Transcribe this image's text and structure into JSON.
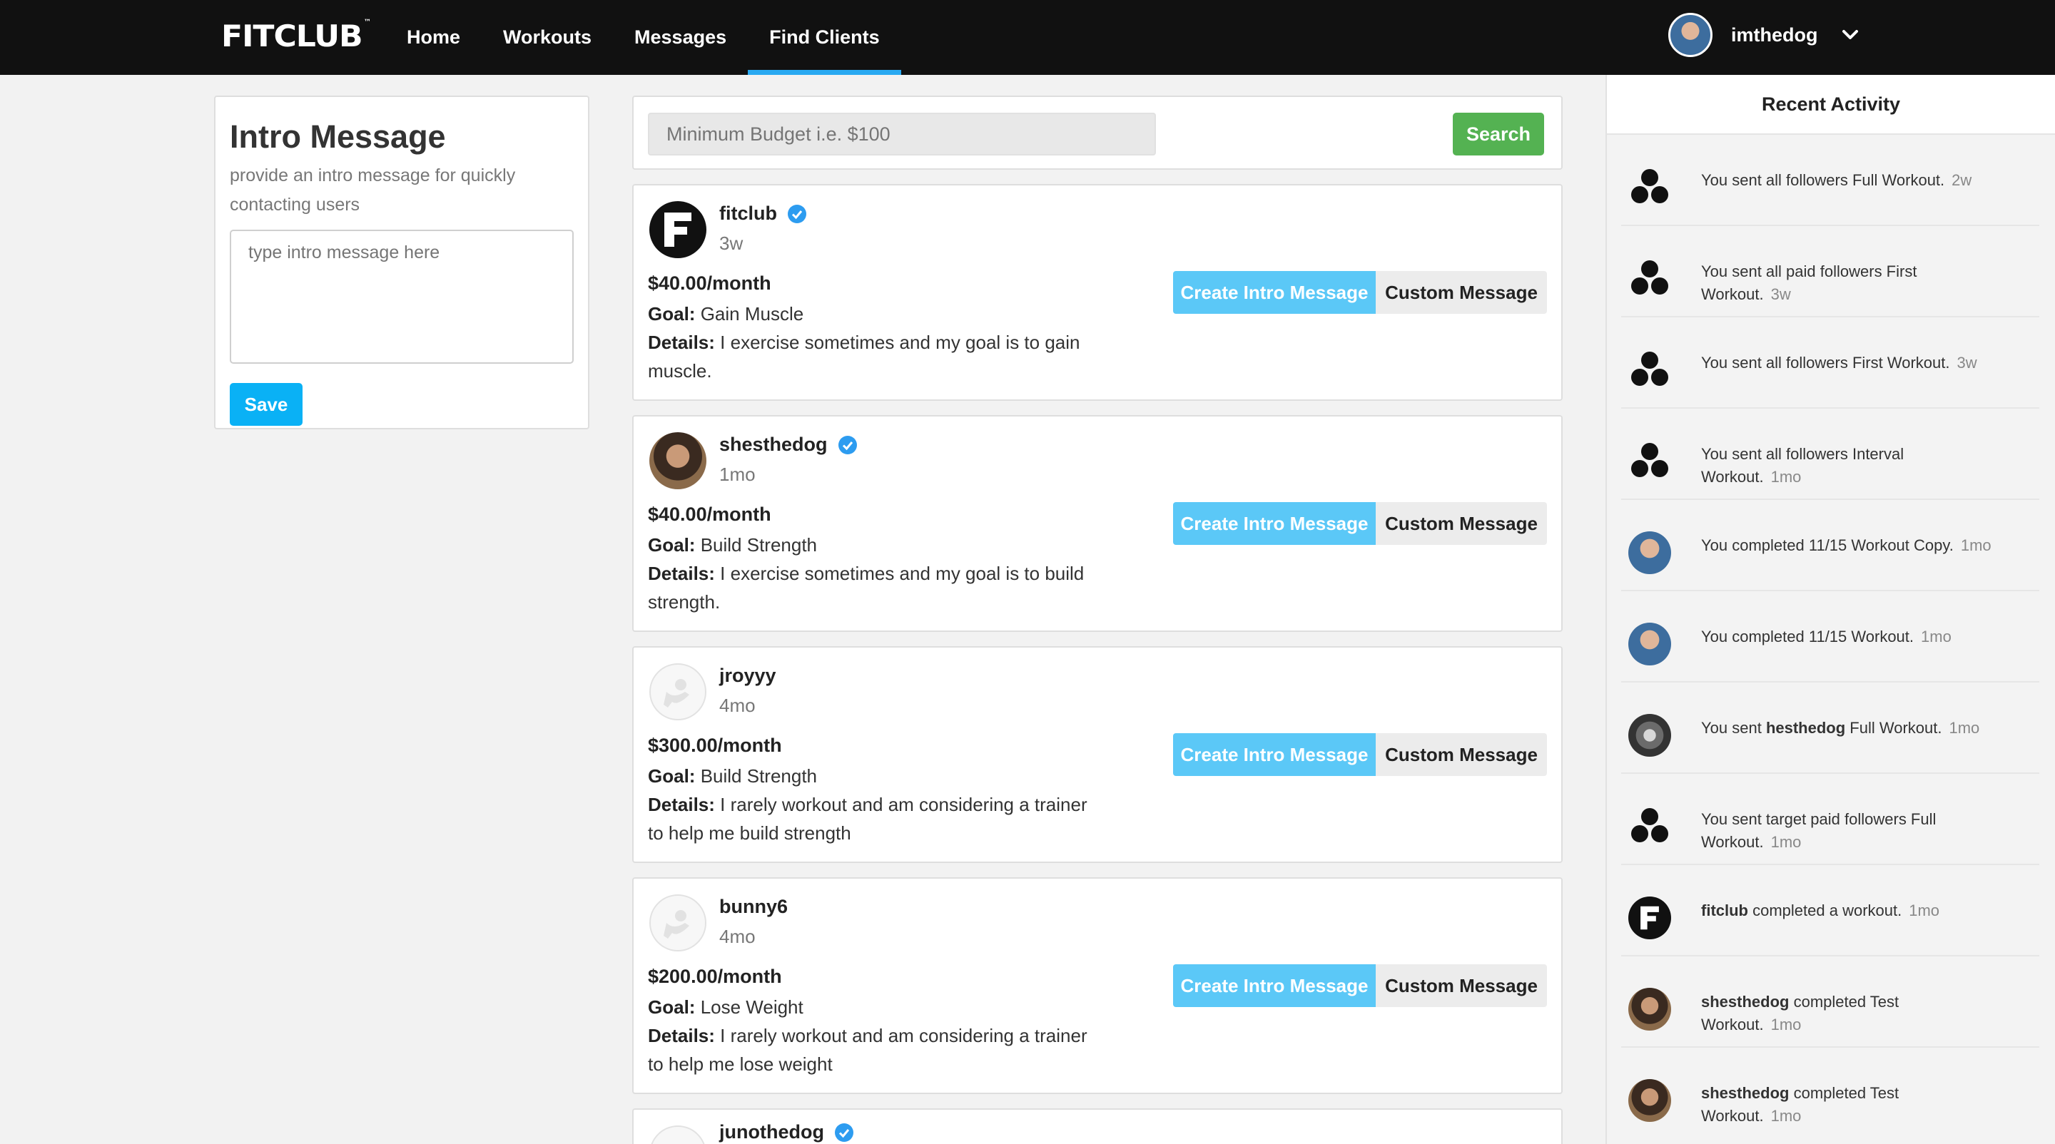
{
  "nav": {
    "brand": "FITCLUB",
    "links": [
      "Home",
      "Workouts",
      "Messages",
      "Find Clients"
    ],
    "active_index": 3,
    "username": "imthedog"
  },
  "intro": {
    "title": "Intro Message",
    "description": "provide an intro message for quickly contacting users",
    "textarea_placeholder": "type intro message here",
    "save_label": "Save"
  },
  "search": {
    "placeholder": "Minimum Budget i.e. $100",
    "button_label": "Search"
  },
  "clients": [
    {
      "name": "fitclub",
      "verified": true,
      "time": "3w",
      "price": "$40.00/month",
      "goal": "Gain Muscle",
      "details": "I exercise sometimes and my goal is to gain muscle.",
      "avatar": "fitclub-logo"
    },
    {
      "name": "shesthedog",
      "verified": true,
      "time": "1mo",
      "price": "$40.00/month",
      "goal": "Build Strength",
      "details": "I exercise sometimes and my goal is to build strength.",
      "avatar": "photo"
    },
    {
      "name": "jroyyy",
      "verified": false,
      "time": "4mo",
      "price": "$300.00/month",
      "goal": "Build Strength",
      "details": "I rarely workout and am considering a trainer to help me build strength",
      "avatar": "default"
    },
    {
      "name": "bunny6",
      "verified": false,
      "time": "4mo",
      "price": "$200.00/month",
      "goal": "Lose Weight",
      "details": "I rarely workout and am considering a trainer to help me lose weight",
      "avatar": "default"
    },
    {
      "name": "junothedog",
      "verified": true,
      "avatar": "default"
    }
  ],
  "labels": {
    "goal": "Goal:",
    "details": "Details:",
    "create_intro": "Create Intro Message",
    "custom_message": "Custom Message"
  },
  "activity": {
    "title": "Recent Activity",
    "items": [
      {
        "icon": "three-dots-icon",
        "bold": "",
        "text": "You sent all followers Full Workout.",
        "time": "2w"
      },
      {
        "icon": "three-dots-icon",
        "bold": "",
        "text": "You sent all paid followers First Workout.",
        "time": "3w"
      },
      {
        "icon": "three-dots-icon",
        "bold": "",
        "text": "You sent all followers First Workout.",
        "time": "3w"
      },
      {
        "icon": "three-dots-icon",
        "bold": "",
        "text": "You sent all followers Interval Workout.",
        "time": "1mo"
      },
      {
        "icon": "user-avatar",
        "bold": "",
        "text": "You completed 11/15 Workout Copy.",
        "time": "1mo"
      },
      {
        "icon": "user-avatar",
        "bold": "",
        "text": "You completed 11/15 Workout.",
        "time": "1mo"
      },
      {
        "icon": "wolf-avatar",
        "pre": "You sent ",
        "bold": "hesthedog",
        "text": " Full Workout.",
        "time": "1mo"
      },
      {
        "icon": "three-dots-icon",
        "bold": "",
        "text": "You sent target paid followers Full Workout.",
        "time": "1mo"
      },
      {
        "icon": "fitclub-logo",
        "bold": "fitclub",
        "text": " completed a workout.",
        "time": "1mo"
      },
      {
        "icon": "shes-avatar",
        "bold": "shesthedog",
        "text": " completed Test Workout.",
        "time": "1mo"
      },
      {
        "icon": "shes-avatar",
        "bold": "shesthedog",
        "text": " completed Test Workout.",
        "time": "1mo"
      }
    ]
  }
}
